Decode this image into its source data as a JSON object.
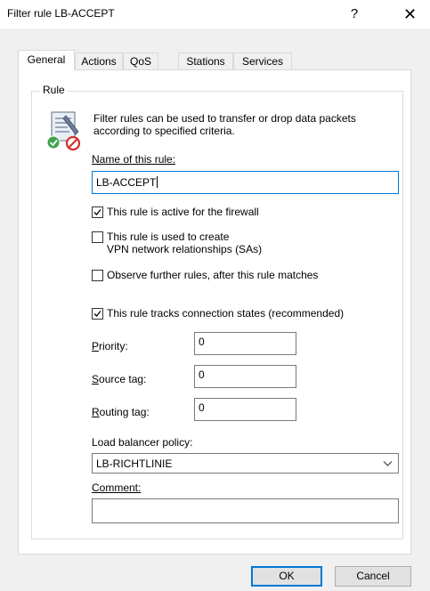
{
  "window": {
    "title": "Filter rule LB-ACCEPT",
    "help_glyph": "?",
    "close_glyph": "✕"
  },
  "tabs": [
    {
      "label": "General",
      "active": true
    },
    {
      "label": "Actions",
      "active": false
    },
    {
      "label": "QoS",
      "active": false
    },
    {
      "label": "Stations",
      "active": false
    },
    {
      "label": "Services",
      "active": false
    }
  ],
  "rule_group": {
    "legend": "Rule",
    "icon": "filter-rule-document-icon",
    "description_line1": "Filter rules can be used to transfer or drop data packets",
    "description_line2": "according to specified criteria."
  },
  "name_field": {
    "label": "Name of this rule:",
    "value": "LB-ACCEPT"
  },
  "checkboxes": {
    "active_firewall": {
      "label": "This rule is active for the firewall",
      "checked": true
    },
    "vpn_line1": {
      "label": "This rule is used to create",
      "checked": false
    },
    "vpn_line2": "VPN network relationships (SAs)",
    "observe_further": {
      "label": "Observe further rules, after this rule matches",
      "checked": false
    },
    "tracks_connections": {
      "label": "This rule tracks connection states (recommended)",
      "checked": true
    }
  },
  "priority": {
    "label": "Priority:",
    "value": "0"
  },
  "source_tag": {
    "label": "Source tag:",
    "value": "0"
  },
  "routing_tag": {
    "label": "Routing tag:",
    "value": "0"
  },
  "load_balancer": {
    "label": "Load balancer policy:",
    "selected": "LB-RICHTLINIE"
  },
  "comment": {
    "label": "Comment:",
    "value": ""
  },
  "buttons": {
    "ok": "OK",
    "cancel": "Cancel"
  },
  "colors": {
    "focus_border": "#0078d7",
    "dialog_bg": "#f0f0f0",
    "panel_bg": "#ffffff"
  }
}
